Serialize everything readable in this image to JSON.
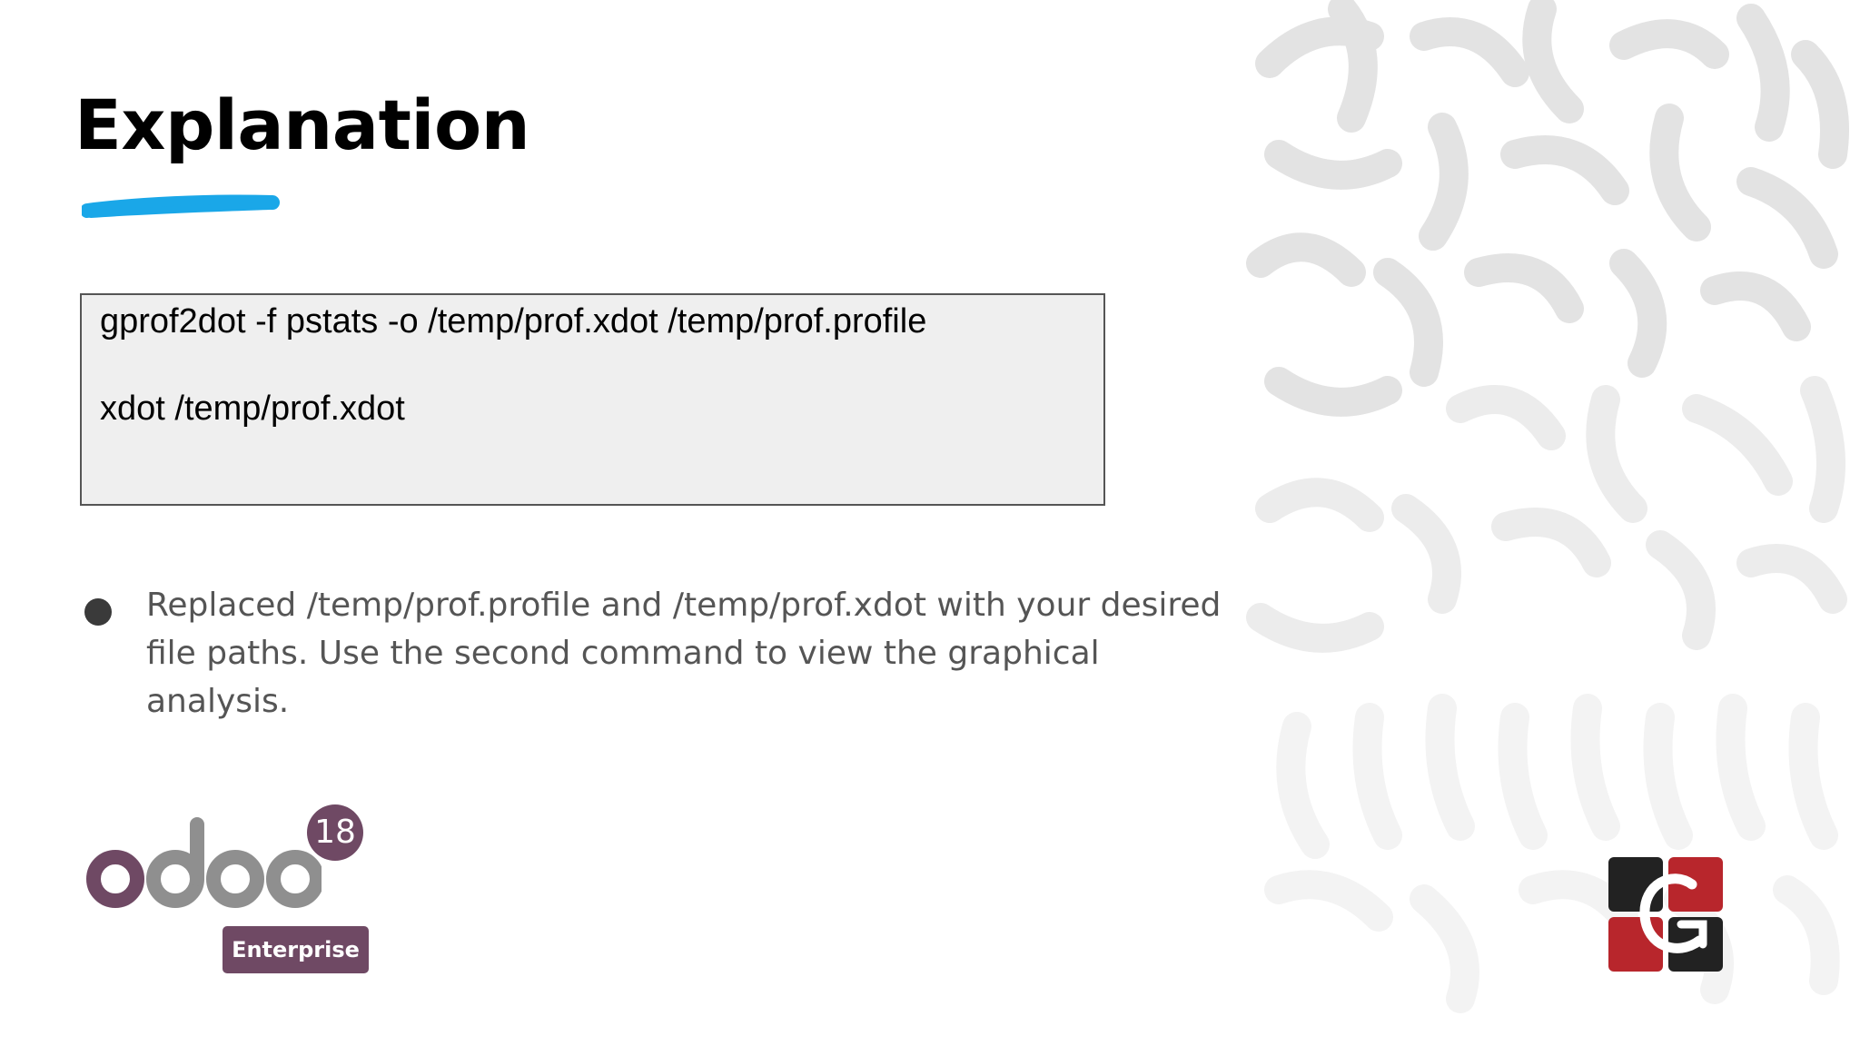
{
  "slide": {
    "title": "Explanation",
    "accent_color": "#1aa7e8"
  },
  "code_box": {
    "lines": [
      "gprof2dot -f pstats -o /temp/prof.xdot /temp/prof.profile",
      "xdot /temp/prof.xdot"
    ]
  },
  "bullets": [
    "Replaced /temp/prof.profile and /temp/prof.xdot with your desired file paths. Use the second command to view the graphical analysis."
  ],
  "odoo_logo": {
    "wordmark": "odoo",
    "version": "18",
    "edition": "Enterprise",
    "purple": "#6f4964",
    "grey": "#8f8f8f"
  },
  "company_logo": {
    "icon": "cybrosys-logo",
    "colors": [
      "#222222",
      "#b8262c",
      "#ffffff"
    ]
  },
  "background": {
    "pattern": "grey-squiggle-pattern"
  }
}
